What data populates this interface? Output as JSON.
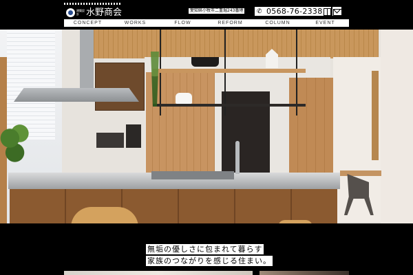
{
  "header": {
    "logo_small_text": "建築設計",
    "logo_name": "水野商会",
    "address": "愛知県小牧市二重堀243番地",
    "phone": "0568-76-2338"
  },
  "nav": {
    "items": [
      "CONCEPT",
      "WORKS",
      "FLOW",
      "REFORM",
      "COLUMN",
      "EVENT"
    ]
  },
  "hero": {
    "tagline_line1": "無垢の優しさに包まれて暮らす",
    "tagline_line2": "家族のつながりを感じる住まい。"
  },
  "icons": {
    "phone": "phone-icon",
    "book": "book-icon",
    "mail": "mail-icon"
  }
}
